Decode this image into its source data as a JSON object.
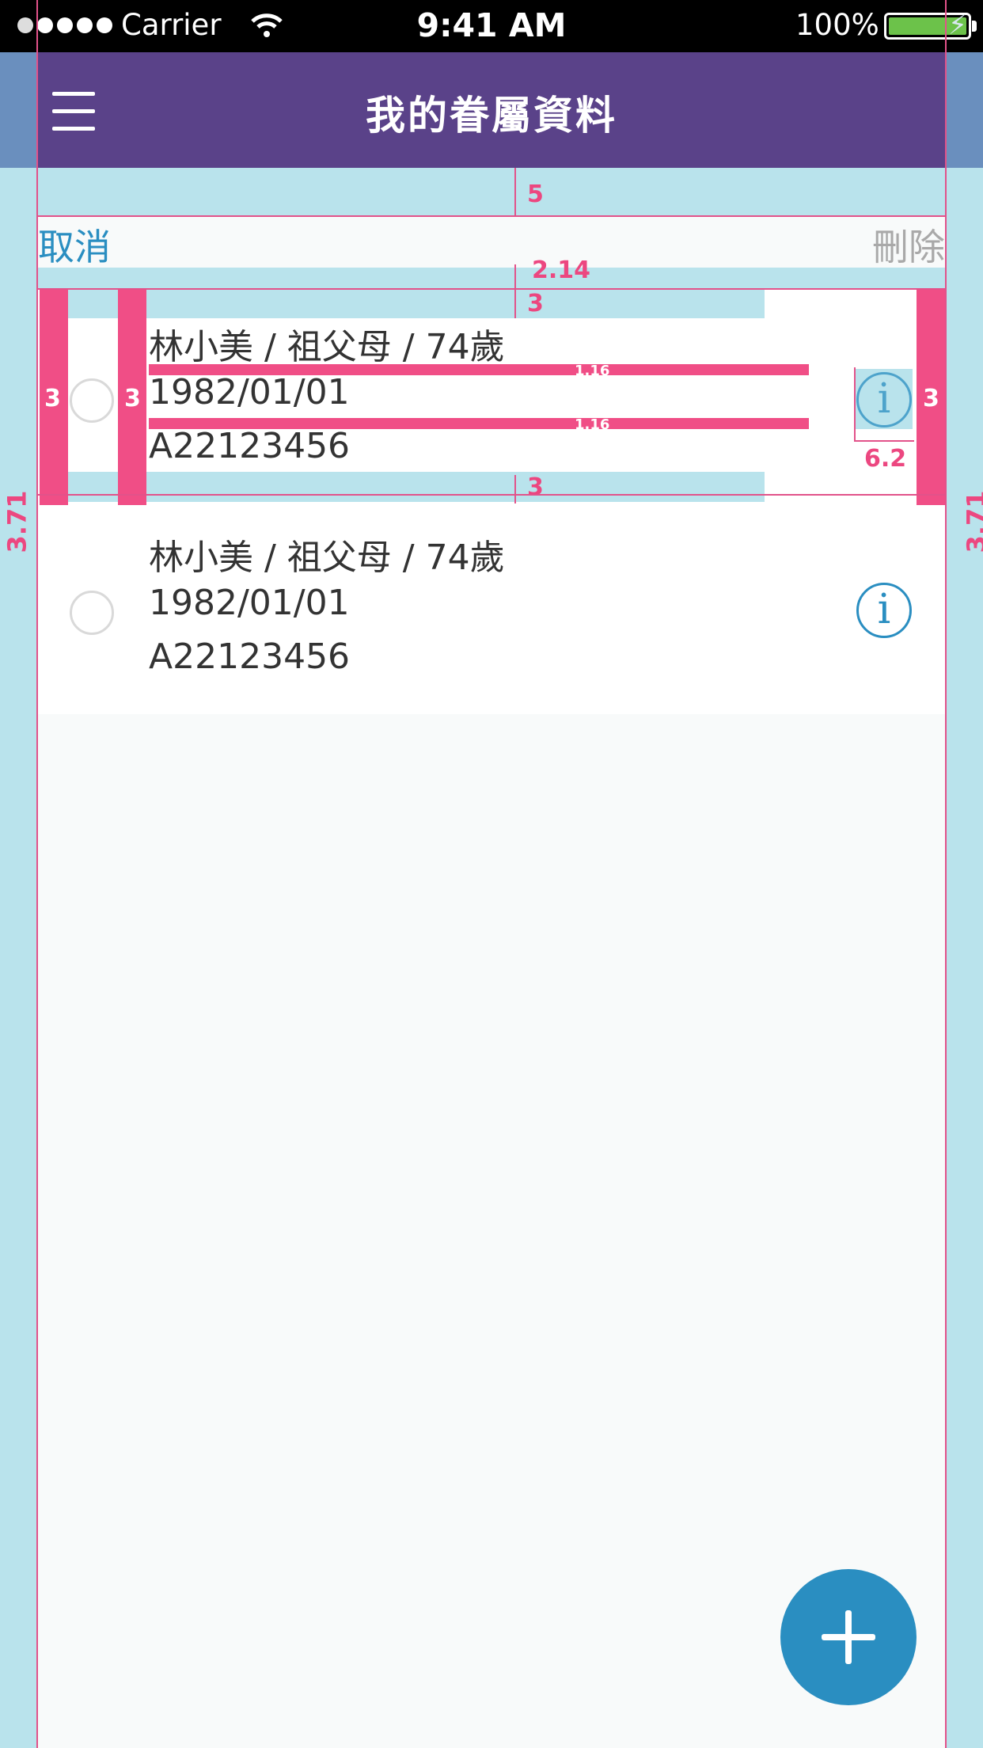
{
  "status_bar": {
    "carrier": "Carrier",
    "time": "9:41 AM",
    "battery": "100%"
  },
  "nav": {
    "title": "我的眷屬資料",
    "menu_icon": "hamburger-icon"
  },
  "actions": {
    "cancel_label": "取消",
    "delete_label": "刪除"
  },
  "dependents": [
    {
      "summary": "林小美 / 祖父母 / 74歲",
      "birthdate": "1982/01/01",
      "id_number": "A22123456"
    },
    {
      "summary": "林小美 / 祖父母 / 74歲",
      "birthdate": "1982/01/01",
      "id_number": "A22123456"
    }
  ],
  "annotations": {
    "top_gap": "5",
    "action_gap": "2.14",
    "row_top_pad": "3",
    "row_bottom_pad": "3",
    "left_pad": "3",
    "radio_pad": "3",
    "right_pad": "3",
    "line_gap_1": "1.16",
    "line_gap_2": "1.16",
    "info_size": "6.2",
    "side_margin_left": "3.71",
    "side_margin_right": "3.71"
  },
  "colors": {
    "nav": "#5a4289",
    "accent": "#2a8ec1",
    "annotation": "#f04e86",
    "guide": "#b9e3ec"
  }
}
